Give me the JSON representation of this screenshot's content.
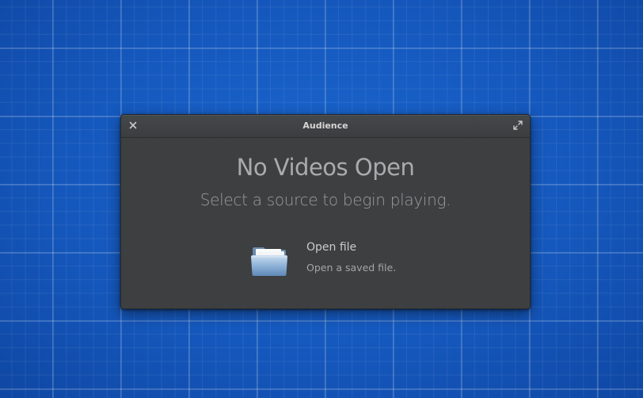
{
  "window": {
    "title": "Audience",
    "close_icon": "close-icon",
    "maximize_icon": "maximize-icon"
  },
  "welcome": {
    "heading": "No Videos Open",
    "subheading": "Select a source to begin playing.",
    "items": [
      {
        "title": "Open file",
        "description": "Open a saved file.",
        "icon": "folder-icon"
      }
    ]
  },
  "colors": {
    "desktop_background": "#1656b8",
    "window_background": "#3d3f41",
    "text_primary": "#c9cbcd",
    "text_secondary": "#a3a5a7"
  }
}
